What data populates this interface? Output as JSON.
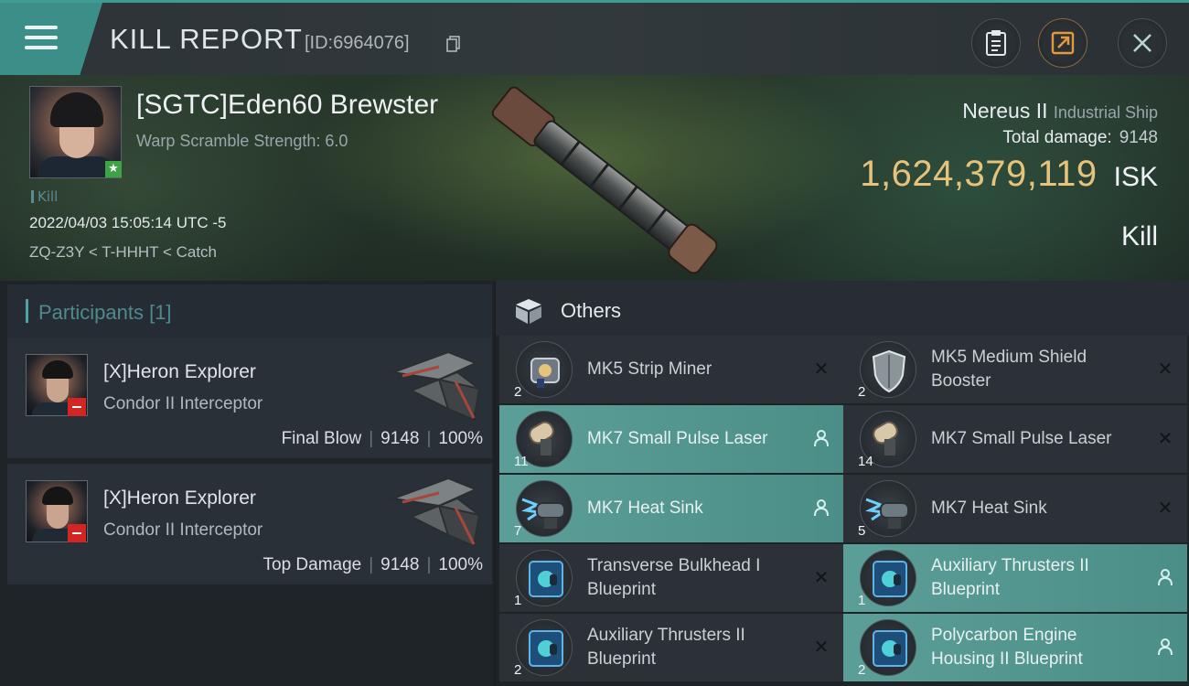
{
  "header": {
    "title": "KILL REPORT",
    "report_id": "[ID:6964076]"
  },
  "victim": {
    "name": "[SGTC]Eden60 Brewster",
    "warp_scramble": "Warp Scramble Strength: 6.0",
    "tag": "Kill",
    "datetime": "2022/04/03 15:05:14 UTC -5",
    "route": "ZQ-Z3Y < T-HHHT < Catch",
    "ship_name": "Nereus II",
    "ship_class": "Industrial Ship",
    "total_damage_label": "Total damage:",
    "total_damage": "9148",
    "isk_value": "1,624,379,119",
    "isk_unit": "ISK",
    "result": "Kill"
  },
  "participants": {
    "title": "Participants",
    "count": "[1]",
    "list": [
      {
        "name": "[X]Heron Explorer",
        "ship": "Condor II Interceptor",
        "role": "Final Blow",
        "damage": "9148",
        "percent": "100%",
        "sep": "|"
      },
      {
        "name": "[X]Heron Explorer",
        "ship": "Condor II Interceptor",
        "role": "Top Damage",
        "damage": "9148",
        "percent": "100%",
        "sep": "|"
      }
    ]
  },
  "others": {
    "title": "Others",
    "items": [
      {
        "name": "MK5 Strip Miner",
        "qty": "2",
        "icon": "strip-miner-icon",
        "highlighted": false,
        "action": "close-icon"
      },
      {
        "name": "MK5 Medium Shield Booster",
        "qty": "2",
        "icon": "shield-booster-icon",
        "highlighted": false,
        "action": "close-icon"
      },
      {
        "name": "MK7 Small Pulse Laser",
        "qty": "11",
        "icon": "pulse-laser-icon",
        "highlighted": true,
        "action": "person-icon"
      },
      {
        "name": "MK7 Small Pulse Laser",
        "qty": "14",
        "icon": "pulse-laser-icon",
        "highlighted": false,
        "action": "close-icon"
      },
      {
        "name": "MK7 Heat Sink",
        "qty": "7",
        "icon": "heat-sink-icon",
        "highlighted": true,
        "action": "person-icon"
      },
      {
        "name": "MK7 Heat Sink",
        "qty": "5",
        "icon": "heat-sink-icon",
        "highlighted": false,
        "action": "close-icon"
      },
      {
        "name": "Transverse Bulkhead I Blueprint",
        "qty": "1",
        "icon": "blueprint-icon",
        "highlighted": false,
        "action": "close-icon"
      },
      {
        "name": "Auxiliary Thrusters II Blueprint",
        "qty": "1",
        "icon": "blueprint-icon",
        "highlighted": true,
        "action": "person-icon"
      },
      {
        "name": "Auxiliary Thrusters II Blueprint",
        "qty": "2",
        "icon": "blueprint-icon",
        "highlighted": false,
        "action": "close-icon"
      },
      {
        "name": "Polycarbon Engine Housing II Blueprint",
        "qty": "2",
        "icon": "blueprint-icon",
        "highlighted": true,
        "action": "person-icon"
      }
    ]
  },
  "colors": {
    "accent": "#3d9c93",
    "isk": "#e7c27a",
    "highlight_row": "#5b9f98",
    "hostile_badge": "#d42525",
    "friendly_badge": "#3ea345"
  }
}
